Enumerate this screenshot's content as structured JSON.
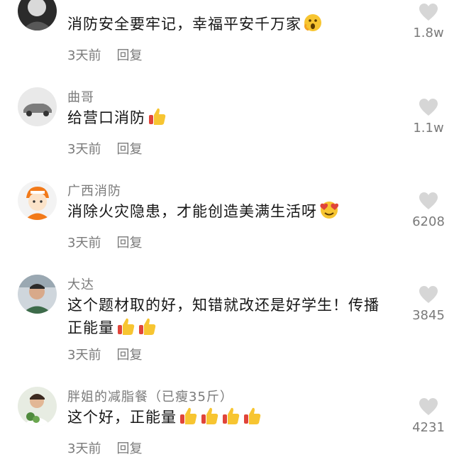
{
  "comments": [
    {
      "username": "",
      "text": "消防安全要牢记，幸福平安千万家",
      "time": "3天前",
      "reply": "回复",
      "likes": "1.8w",
      "emojis": [
        "surprised-face"
      ]
    },
    {
      "username": "曲哥",
      "text": "给营口消防",
      "time": "3天前",
      "reply": "回复",
      "likes": "1.1w",
      "emojis": [
        "thumbs-up"
      ]
    },
    {
      "username": "广西消防",
      "text": "消除火灾隐患，才能创造美满生活呀",
      "time": "3天前",
      "reply": "回复",
      "likes": "6208",
      "emojis": [
        "heart-face"
      ]
    },
    {
      "username": "大达",
      "text_line1": "这个题材取的好，知错就改还是好学生！传播",
      "text_line2": "正能量",
      "time": "3天前",
      "reply": "回复",
      "likes": "3845",
      "emojis": [
        "thumbs-up",
        "thumbs-up"
      ]
    },
    {
      "username": "胖姐的减脂餐（已瘦35斤）",
      "text": "这个好，正能量",
      "time": "3天前",
      "reply": "回复",
      "likes": "4231",
      "emojis": [
        "thumbs-up",
        "thumbs-up",
        "thumbs-up",
        "thumbs-up"
      ]
    }
  ],
  "colors": {
    "secondary_text": "#7a7a7a",
    "primary_text": "#161616",
    "heart": "#d6d6d6"
  }
}
